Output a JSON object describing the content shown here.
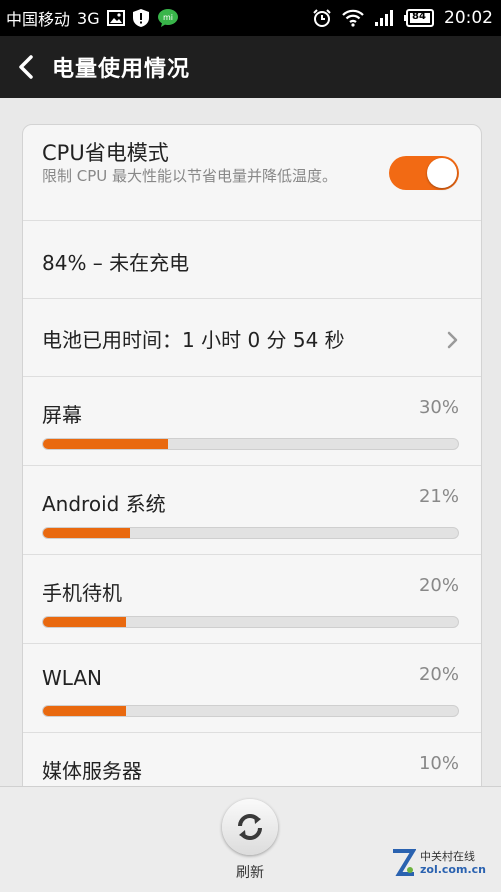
{
  "status_bar": {
    "carrier": "中国移动",
    "network": "3G",
    "battery_level": "84",
    "time": "20:02"
  },
  "header": {
    "title": "电量使用情况"
  },
  "cpu_mode": {
    "title": "CPU省电模式",
    "description": "限制 CPU 最大性能以节省电量并降低温度。",
    "enabled": true
  },
  "battery_status": "84% – 未在充电",
  "battery_time": "电池已用时间：1 小时 0 分 54 秒",
  "usage": [
    {
      "name": "屏幕",
      "percent_label": "30%",
      "fraction": 0.3
    },
    {
      "name": "Android 系统",
      "percent_label": "21%",
      "fraction": 0.21
    },
    {
      "name": "手机待机",
      "percent_label": "20%",
      "fraction": 0.2
    },
    {
      "name": "WLAN",
      "percent_label": "20%",
      "fraction": 0.2
    },
    {
      "name": "媒体服务器",
      "percent_label": "10%",
      "fraction": 0.1
    }
  ],
  "bottom": {
    "refresh_label": "刷新"
  },
  "watermark": {
    "cn": "中关村在线",
    "en": "zol.com.cn"
  },
  "colors": {
    "accent": "#f26a14",
    "bar_fill": "#e9690f"
  }
}
